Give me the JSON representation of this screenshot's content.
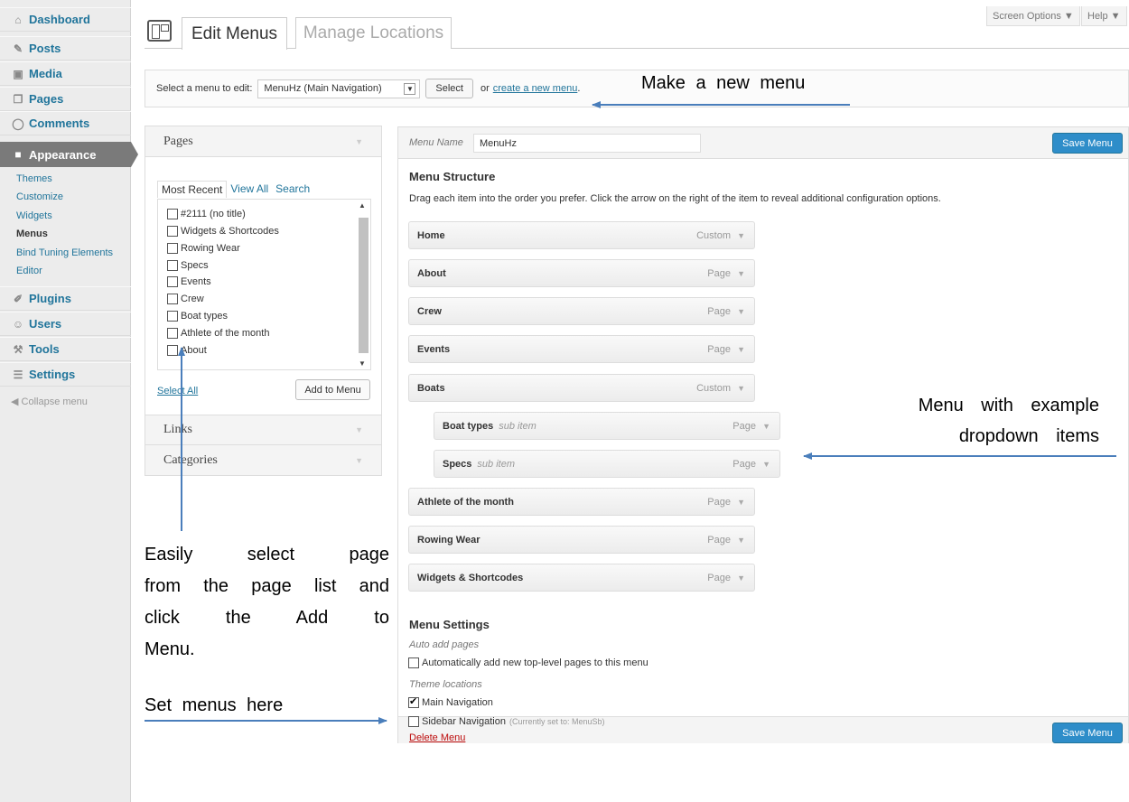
{
  "sidebar": {
    "items": [
      {
        "label": "Dashboard",
        "icon": "house-icon",
        "glyph": "⌂"
      },
      {
        "label": "Posts",
        "icon": "pin-icon",
        "glyph": "✎"
      },
      {
        "label": "Media",
        "icon": "media-icon",
        "glyph": "▣"
      },
      {
        "label": "Pages",
        "icon": "pages-icon",
        "glyph": "❐"
      },
      {
        "label": "Comments",
        "icon": "comment-icon",
        "glyph": "◯"
      },
      {
        "label": "Appearance",
        "icon": "appearance-icon",
        "glyph": "■"
      },
      {
        "label": "Plugins",
        "icon": "plug-icon",
        "glyph": "✐"
      },
      {
        "label": "Users",
        "icon": "users-icon",
        "glyph": "☺"
      },
      {
        "label": "Tools",
        "icon": "tools-icon",
        "glyph": "⚒"
      },
      {
        "label": "Settings",
        "icon": "settings-icon",
        "glyph": "☰"
      }
    ],
    "appearance_sub": [
      "Themes",
      "Customize",
      "Widgets",
      "Menus",
      "Bind Tuning Elements",
      "Editor"
    ],
    "collapse": "Collapse menu"
  },
  "header": {
    "screen_options": "Screen Options ▼",
    "help": "Help ▼",
    "tab_edit": "Edit Menus",
    "tab_manage": "Manage Locations"
  },
  "select_bar": {
    "label": "Select a menu to edit:",
    "selected": "MenuHz (Main Navigation)",
    "select_button": "Select",
    "or": "or",
    "create_link": "create a new menu",
    "period": "."
  },
  "left_panel": {
    "pages_title": "Pages",
    "tabs": [
      "Most Recent",
      "View All",
      "Search"
    ],
    "pages": [
      "#2111 (no title)",
      "Widgets & Shortcodes",
      "Rowing Wear",
      "Specs",
      "Events",
      "Crew",
      "Boat types",
      "Athlete of the month",
      "About"
    ],
    "select_all": "Select All",
    "add_button": "Add to Menu",
    "links_title": "Links",
    "categories_title": "Categories"
  },
  "editor": {
    "menu_name_label": "Menu Name",
    "menu_name": "MenuHz",
    "save": "Save Menu",
    "structure_title": "Menu Structure",
    "instructions": "Drag each item into the order you prefer. Click the arrow on the right of the item to reveal additional configuration options.",
    "items": [
      {
        "label": "Home",
        "type": "Custom",
        "sub": ""
      },
      {
        "label": "About",
        "type": "Page",
        "sub": ""
      },
      {
        "label": "Crew",
        "type": "Page",
        "sub": ""
      },
      {
        "label": "Events",
        "type": "Page",
        "sub": ""
      },
      {
        "label": "Boats",
        "type": "Custom",
        "sub": ""
      },
      {
        "label": "Boat types",
        "type": "Page",
        "sub": "sub item"
      },
      {
        "label": "Specs",
        "type": "Page",
        "sub": "sub item"
      },
      {
        "label": "Athlete of the month",
        "type": "Page",
        "sub": ""
      },
      {
        "label": "Rowing Wear",
        "type": "Page",
        "sub": ""
      },
      {
        "label": "Widgets & Shortcodes",
        "type": "Page",
        "sub": ""
      }
    ],
    "settings_title": "Menu Settings",
    "auto_add_label": "Auto add pages",
    "auto_add_option": "Automatically add new top-level pages to this menu",
    "theme_locations_label": "Theme locations",
    "main_nav": "Main Navigation",
    "sidebar_nav": "Sidebar Navigation",
    "sidebar_nav_note": "(Currently set to: MenuSb)",
    "delete": "Delete Menu"
  },
  "annotations": {
    "new_menu": "Make a new menu",
    "dropdown_1": "Menu with example",
    "dropdown_2": "dropdown items",
    "easily_lines": [
      "Easily select page",
      "from the page list and",
      "click the Add to"
    ],
    "easily_last": "Menu.",
    "set_menus": "Set menus here"
  },
  "colors": {
    "accent": "#21759b",
    "save_button": "#2e8dc9",
    "arrow": "#4a7ebb",
    "delete": "#bc0b0b"
  }
}
